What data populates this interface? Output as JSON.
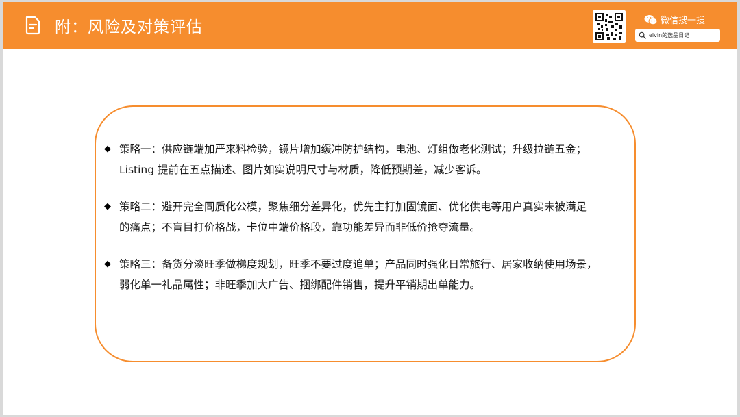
{
  "header": {
    "title": "附：风险及对策评估",
    "wechat_label": "微信搜一搜",
    "search_text": "elvin的选品日记"
  },
  "strategies": [
    {
      "bullet": "◆",
      "lines": [
        "策略一：供应链端加严来料检验，镜片增加缓冲防护结构，电池、灯组做老化测试；升级拉链五金；",
        "Listing 提前在五点描述、图片如实说明尺寸与材质，降低预期差，减少客诉。"
      ]
    },
    {
      "bullet": "◆",
      "lines": [
        "策略二：避开完全同质化公模，聚焦细分差异化，优先主打加固镜面、优化供电等用户真实未被满足",
        "的痛点；不盲目打价格战，卡位中端价格段，靠功能差异而非低价抢夺流量。"
      ]
    },
    {
      "bullet": "◆",
      "lines": [
        "策略三：备货分淡旺季做梯度规划，旺季不要过度追单；产品同时强化日常旅行、居家收纳使用场景，",
        "弱化单一礼品属性；非旺季加大广告、捆绑配件销售，提升平销期出单能力。"
      ]
    }
  ],
  "colors": {
    "accent": "#F68D2E",
    "background": "#ffffff",
    "text": "#1a1a1a"
  },
  "icons": {
    "header": "document-icon",
    "wechat": "wechat-icon",
    "search": "search-icon",
    "qr": "qr-code"
  }
}
